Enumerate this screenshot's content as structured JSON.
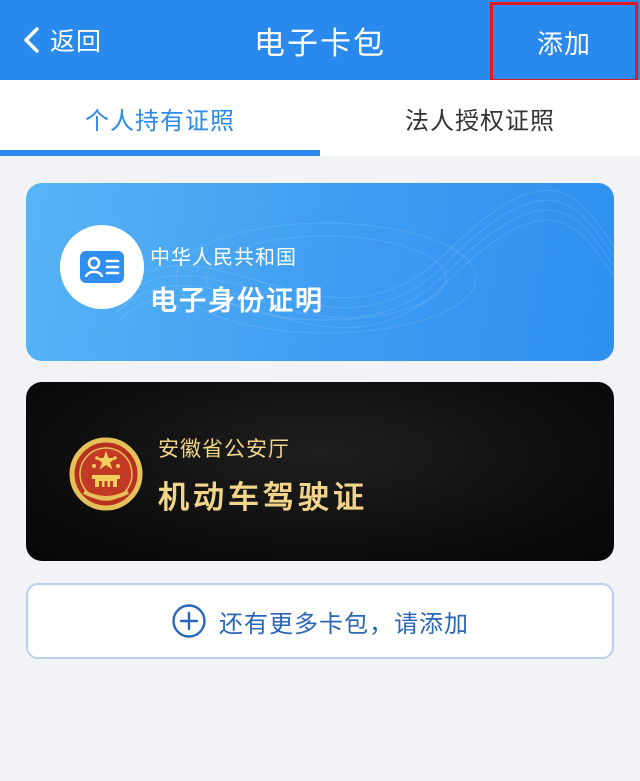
{
  "header": {
    "back_label": "返回",
    "back_icon": "chevron-left-icon",
    "title": "电子卡包",
    "add_label": "添加"
  },
  "tabs": [
    {
      "label": "个人持有证照",
      "active": true
    },
    {
      "label": "法人授权证照",
      "active": false
    }
  ],
  "cards": {
    "id_card": {
      "icon": "id-card-icon",
      "issuer": "中华人民共和国",
      "name": "电子身份证明"
    },
    "driving_license": {
      "icon": "national-emblem-icon",
      "issuer": "安徽省公安厅",
      "name": "机动车驾驶证"
    }
  },
  "more_button": {
    "icon": "plus-circle-icon",
    "label": "还有更多卡包，请添加"
  },
  "colors": {
    "primary": "#2a89ec",
    "highlight_border": "#e2191e",
    "license_text": "#f3d589",
    "background": "#f1f3f6"
  }
}
